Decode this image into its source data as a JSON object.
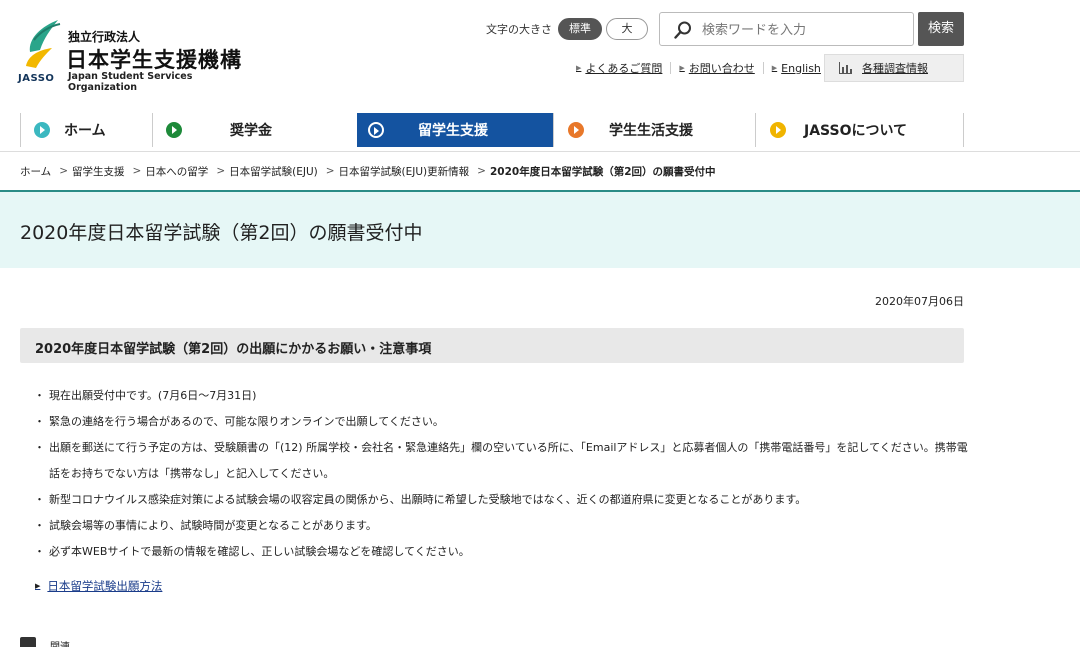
{
  "header": {
    "org_type": "独立行政法人",
    "org_name": "日本学生支援機構",
    "org_abbr": "JASSO",
    "org_name_en": "Japan Student Services Organization",
    "font_size_label": "文字の大きさ",
    "font_size_options": [
      "標準",
      "大"
    ],
    "search_placeholder": "検索ワードを入力",
    "search_button": "検索",
    "util_links": [
      "よくあるご質問",
      "お問い合わせ",
      "English"
    ],
    "survey_label": "各種調査情報"
  },
  "nav": {
    "items": [
      {
        "label": "ホーム",
        "color": "#3bb8c0"
      },
      {
        "label": "奨学金",
        "color": "#1e8a3a"
      },
      {
        "label": "留学生支援",
        "color": "#1453a0"
      },
      {
        "label": "学生生活支援",
        "color": "#e8782a"
      },
      {
        "label": "JASSOについて",
        "color": "#f0b400"
      }
    ],
    "active_index": 2
  },
  "breadcrumb": {
    "items": [
      "ホーム",
      "留学生支援",
      "日本への留学",
      "日本留学試験(EJU)",
      "日本留学試験(EJU)更新情報"
    ],
    "current": "2020年度日本留学試験（第2回）の願書受付中"
  },
  "page": {
    "title": "2020年度日本留学試験（第2回）の願書受付中",
    "date": "2020年07月06日",
    "section_title": "2020年度日本留学試験（第2回）の出願にかかるお願い・注意事項",
    "notes": [
      "現在出願受付中です。(7月6日～7月31日)",
      "緊急の連絡を行う場合があるので、可能な限りオンラインで出願してください。",
      "出願を郵送にて行う予定の方は、受験願書の「(12) 所属学校・会社名・緊急連絡先」欄の空いている所に、「Emailアドレス」と応募者個人の「携帯電話番号」を記してください。携帯電話をお持ちでない方は「携帯なし」と記入してください。",
      "新型コロナウイルス感染症対策による試験会場の収容定員の関係から、出願時に希望した受験地ではなく、近くの都道府県に変更となることがあります。",
      "試験会場等の事情により、試験時間が変更となることがあります。",
      "必ず本WEBサイトで最新の情報を確認し、正しい試験会場などを確認してください。"
    ],
    "method_link": "日本留学試験出願方法",
    "related_label": "関連"
  }
}
